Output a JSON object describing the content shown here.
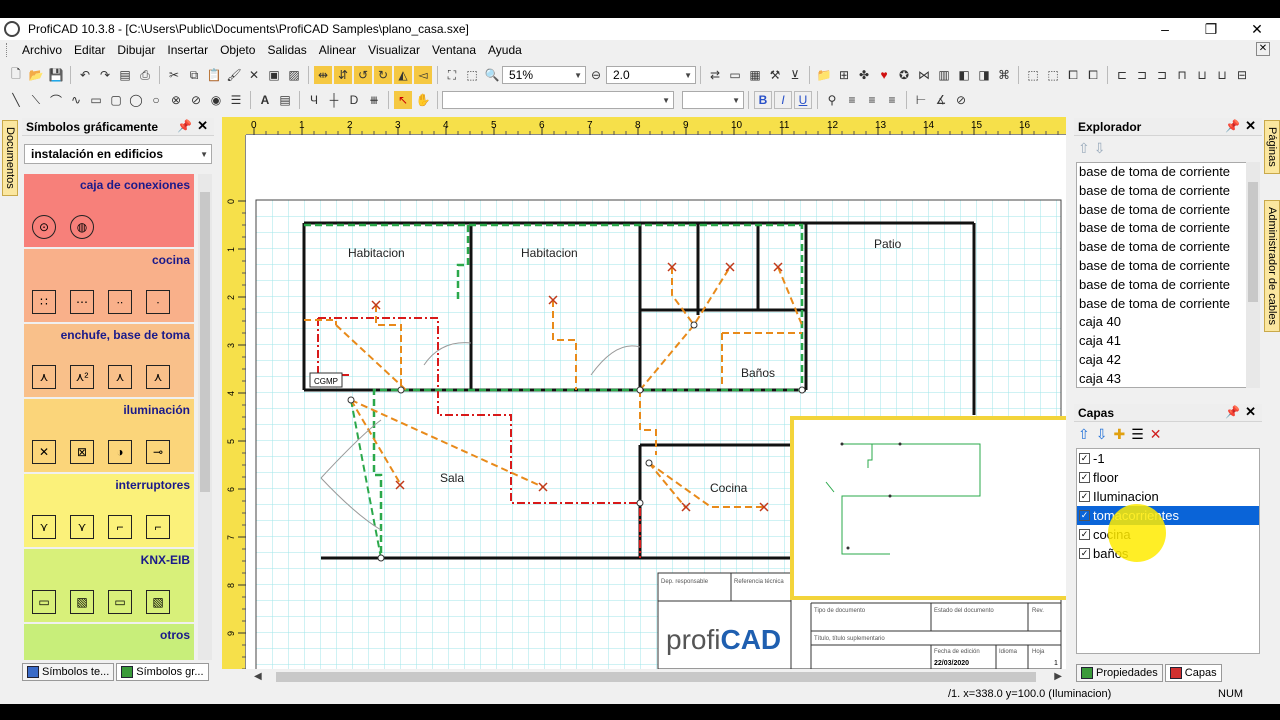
{
  "window": {
    "title": "ProfiCAD 10.3.8 - [C:\\Users\\Public\\Documents\\ProfiCAD Samples\\plano_casa.sxe]",
    "controls": [
      "–",
      "❐",
      "✕"
    ]
  },
  "menu": [
    "Archivo",
    "Editar",
    "Dibujar",
    "Insertar",
    "Objeto",
    "Salidas",
    "Alinear",
    "Visualizar",
    "Ventana",
    "Ayuda"
  ],
  "toolbar": {
    "zoom": "51%",
    "line_width": "2.0",
    "font_name": "",
    "font_size": "",
    "bold": "B",
    "italic": "I",
    "underline": "U"
  },
  "left_strip": {
    "tab": "Documentos"
  },
  "symbols_panel": {
    "title": "Símbolos gráficamente",
    "library": "instalación en edificios",
    "categories": [
      {
        "label": "caja de conexiones",
        "color": "#f7807a",
        "symbols": [
          "⊙",
          "◍"
        ]
      },
      {
        "label": "cocina",
        "color": "#f9b08a",
        "symbols": [
          "∷",
          "⋯",
          "∙∙",
          "∙"
        ]
      },
      {
        "label": "enchufe, base de toma",
        "color": "#f9c08a",
        "symbols": [
          "⋏",
          "⋏²",
          "⋏",
          "⋏"
        ]
      },
      {
        "label": "iluminación",
        "color": "#fbd57a",
        "symbols": [
          "✕",
          "⊠",
          "◑",
          "⊸"
        ]
      },
      {
        "label": "interruptores",
        "color": "#fbf17a",
        "symbols": [
          "⋎",
          "⋎",
          "⌐",
          "⌐"
        ]
      },
      {
        "label": "KNX-EIB",
        "color": "#d8f07a",
        "symbols": [
          "▭",
          "▧",
          "▭",
          "▧"
        ]
      },
      {
        "label": "otros",
        "color": "#c8ee7a",
        "symbols": []
      }
    ],
    "bottom_tabs": [
      "Símbolos te...",
      "Símbolos gr..."
    ]
  },
  "ruler": {
    "top_labels": [
      "0",
      "1",
      "2",
      "3",
      "4",
      "5",
      "6",
      "7",
      "8",
      "9",
      "10",
      "11",
      "12",
      "13",
      "14",
      "15",
      "16"
    ],
    "left_labels": [
      "0",
      "1",
      "2",
      "3",
      "4",
      "5",
      "6",
      "7",
      "8",
      "9"
    ]
  },
  "drawing": {
    "rooms": [
      "Habitacion",
      "Habitacion",
      "Patio",
      "Baños",
      "Sala",
      "Cocina"
    ],
    "box_label": "CGMP",
    "title_block": {
      "dep": "Dep. responsable",
      "ref": "Referencia técnica",
      "tipo": "Tipo de documento",
      "estado": "Estado del documento",
      "rev": "Rev.",
      "titulo": "Título, título suplementario",
      "fecha_label": "Fecha de edición",
      "idioma": "Idioma",
      "hoja": "Hoja",
      "fecha": "22/03/2020",
      "hoja_val": "1",
      "logo_a": "profi",
      "logo_b": "CAD"
    }
  },
  "explorer": {
    "title": "Explorador",
    "items": [
      "base de toma de corriente",
      "base de toma de corriente",
      "base de toma de corriente",
      "base de toma de corriente",
      "base de toma de corriente",
      "base de toma de corriente",
      "base de toma de corriente",
      "base de toma de corriente",
      "caja 40",
      "caja 41",
      "caja 42",
      "caja 43"
    ]
  },
  "layers": {
    "title": "Capas",
    "items": [
      "-1",
      "floor",
      "Iluminacion",
      "tomacorrientes",
      "cocina",
      "baños"
    ],
    "selected": "tomacorrientes"
  },
  "right_tabs": [
    "Propiedades",
    "Capas"
  ],
  "right_strip": [
    "Páginas",
    "Administrador de cables"
  ],
  "status": {
    "coords": "/1.  x=338.0  y=100.0 (Iluminacion)",
    "num": "NUM"
  },
  "colors": {
    "ruler": "#f6e04a",
    "grid": "#9fe6ea",
    "selection": "#0a64d8",
    "green_dashed": "#2aa84a",
    "orange_dashed": "#e88a1a",
    "red_dashdot": "#d81a1a"
  }
}
